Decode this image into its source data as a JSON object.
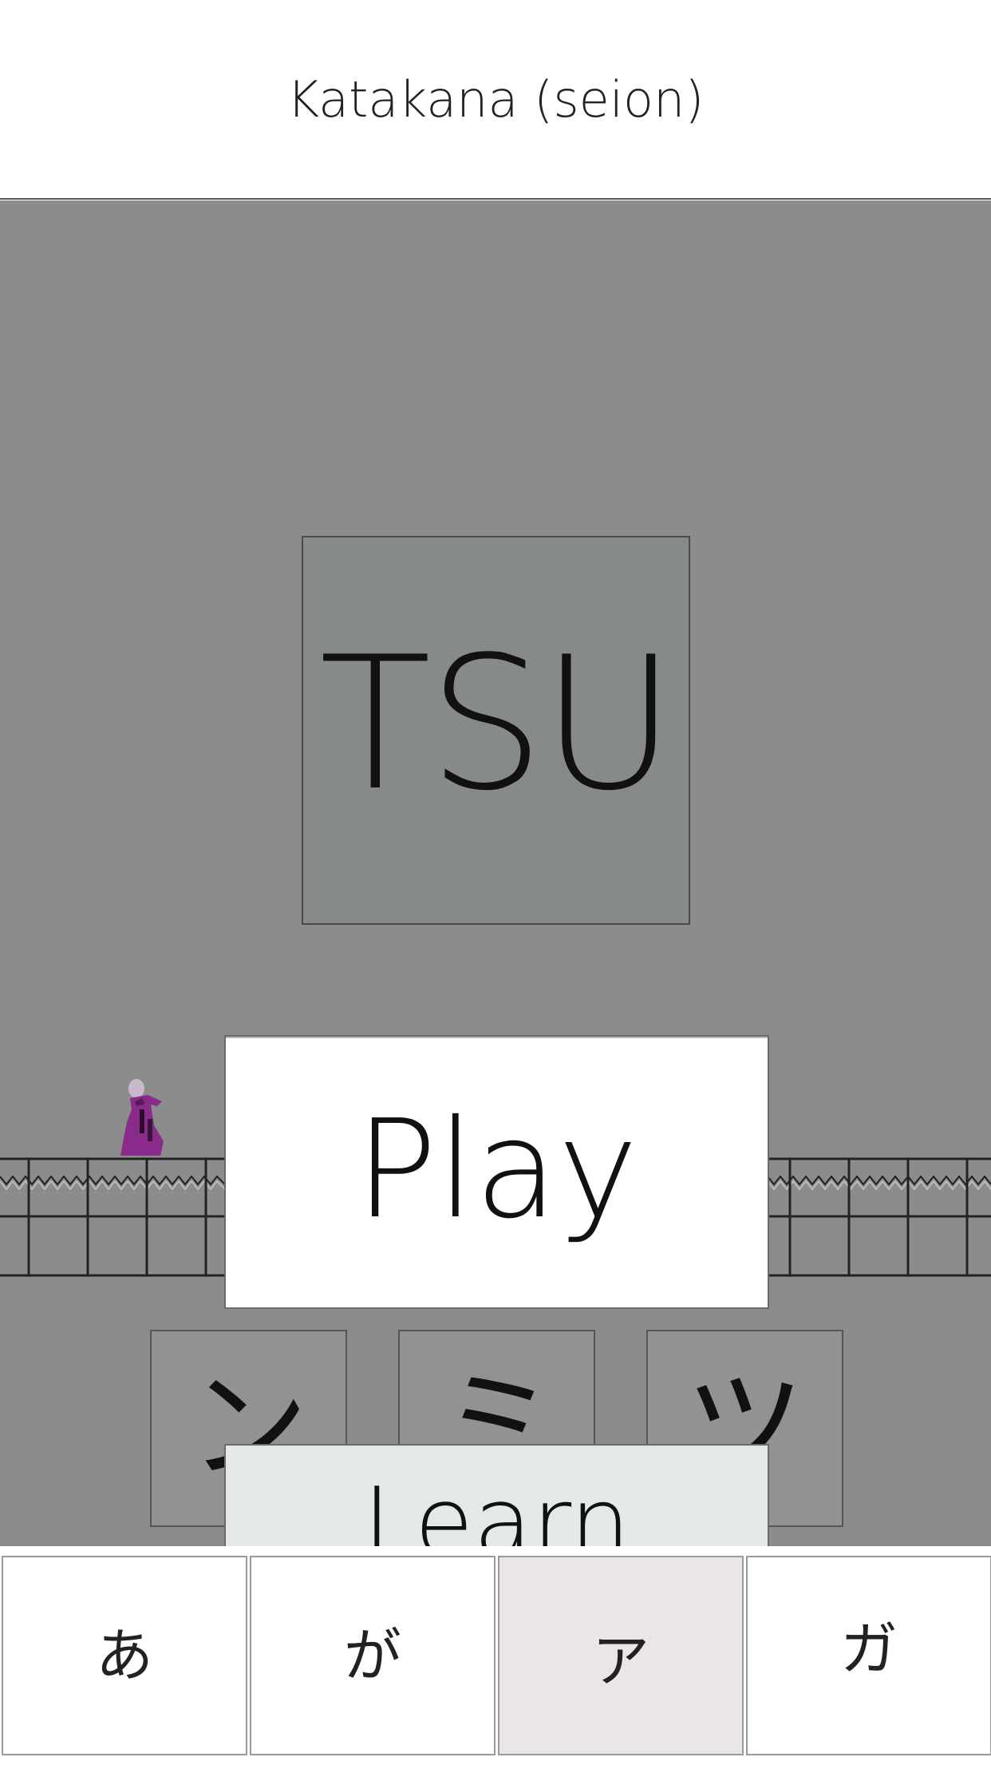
{
  "header": {
    "title": "Katakana (seion)"
  },
  "prompt": {
    "romaji": "TSU"
  },
  "buttons": {
    "play": "Play",
    "learn": "Learn"
  },
  "choices": [
    {
      "glyph": "ン"
    },
    {
      "glyph": "ミ"
    },
    {
      "glyph": "ツ"
    }
  ],
  "tabs": [
    {
      "label": "あ",
      "active": false
    },
    {
      "label": "が",
      "active": false
    },
    {
      "label": "ア",
      "active": true
    },
    {
      "label": "ガ",
      "active": false
    }
  ],
  "colors": {
    "game_background": "#8c8c8c",
    "prompt_card": "#868b88",
    "learn_button": "#e3eae6",
    "active_tab": "#ebe6e6",
    "character": "#8a2a8a"
  },
  "icons": {
    "character": "ninja-sprite"
  }
}
